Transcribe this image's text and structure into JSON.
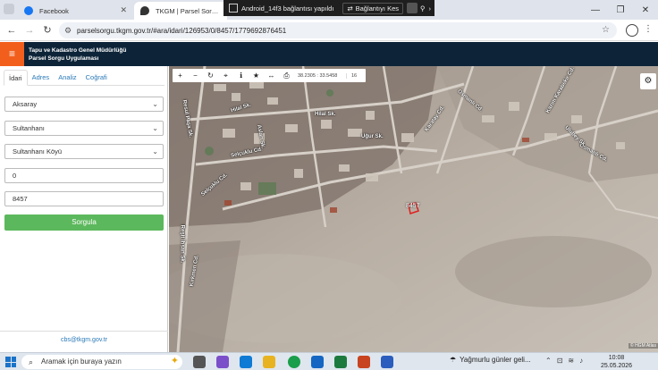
{
  "browser": {
    "tabs": [
      {
        "title": "Facebook",
        "favicon_color": "#1877f2"
      },
      {
        "title": "TKGM | Parsel Sorgu Uygulaması",
        "favicon_color": "#333333"
      }
    ],
    "url": "parselsorgu.tkgm.gov.tr/#ara/idari/126953/0/8457/1779692876451"
  },
  "notification": {
    "title": "Android_14f3 bağlantısı yapıldı",
    "disconnect_label": "Bağlantıyı Kes"
  },
  "app": {
    "title_line1": "Tapu ve Kadastro Genel Müdürlüğü",
    "title_line2": "Parsel Sorgu Uygulaması",
    "accent_color": "#f25f1c",
    "header_color": "#0d2438"
  },
  "panel": {
    "tabs": [
      "İdari",
      "Adres",
      "Analiz",
      "Coğrafi"
    ],
    "active_tab": "İdari",
    "province": "Aksaray",
    "district": "Sultanhanı",
    "neighborhood": "Sultanhanı Köyü",
    "block": "0",
    "parcel": "8457",
    "search_label": "Sorgula",
    "contact_email": "cbs@tkgm.gov.tr"
  },
  "map": {
    "coordinates": "38.2305 : 33.5458",
    "zoom_level": "16",
    "parcel_label": "8457",
    "attribution": "© HGM Atlas",
    "streets": [
      "Hilal Sk.",
      "Hilal Sk.",
      "Selçuklu Cd.",
      "Selçuklu Cd.",
      "Osmanlı Cd.",
      "Osmanlı Cd.",
      "Karatay Cd.",
      "Kazım Karabekir Cd.",
      "Resul Paşa Sk.",
      "Kırkmen Cd.",
      "Reşit İhsan Sk.",
      "Aslan Sk.",
      "Uğur Sk.",
      "Ulubey Sk."
    ]
  },
  "taskbar": {
    "search_placeholder": "Aramak için buraya yazın",
    "weather": "Yağmurlu günler geli...",
    "time": "10:08",
    "date": "25.05.2026"
  }
}
